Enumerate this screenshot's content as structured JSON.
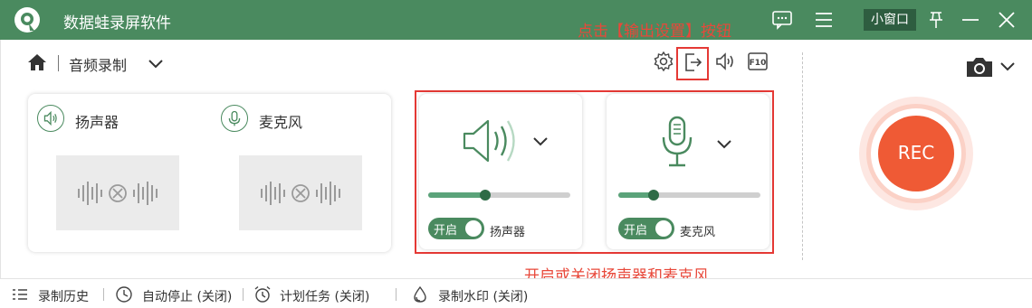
{
  "app": {
    "title": "数据蛙录屏软件",
    "mini_window_label": "小窗口"
  },
  "annotations": {
    "top": "点击【输出设置】按钮",
    "bottom": "开启或关闭扬声器和麦克风"
  },
  "mode": {
    "title": "音频录制"
  },
  "devices_preview": [
    {
      "label": "扬声器",
      "icon": "speaker-icon"
    },
    {
      "label": "麦克风",
      "icon": "microphone-icon"
    }
  ],
  "controls": {
    "speaker": {
      "toggle_label": "开启",
      "label": "扬声器",
      "volume": 0.4,
      "enabled": true
    },
    "microphone": {
      "toggle_label": "开启",
      "label": "麦克风",
      "volume": 0.25,
      "enabled": true
    }
  },
  "record": {
    "label": "REC"
  },
  "statusbar": {
    "history": "录制历史",
    "auto_stop": "自动停止 (关闭)",
    "schedule": "计划任务 (关闭)",
    "watermark": "录制水印 (关闭)"
  },
  "colors": {
    "brand_green": "#4a8a5f",
    "rec_orange": "#ef5a35",
    "annotation_red": "#e53935"
  }
}
